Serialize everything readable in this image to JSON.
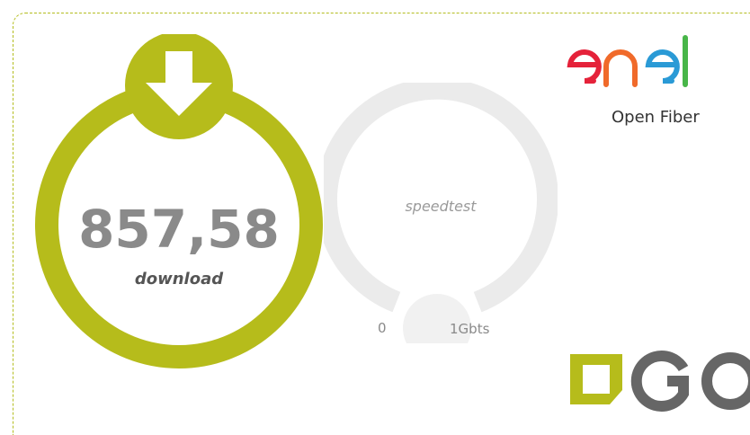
{
  "speedtest": {
    "value": "857,58",
    "metric_label": "download",
    "accent_color": "#b6bc1b",
    "gauge": {
      "title": "speedtest",
      "min_label": "0",
      "max_label": "1Gbts"
    }
  },
  "brands": {
    "openfiber": {
      "wordmark": "enel",
      "subtitle": "Open Fiber"
    },
    "go": {
      "wordmark": "GO"
    }
  },
  "icons": {
    "download": "arrow-down-icon"
  }
}
